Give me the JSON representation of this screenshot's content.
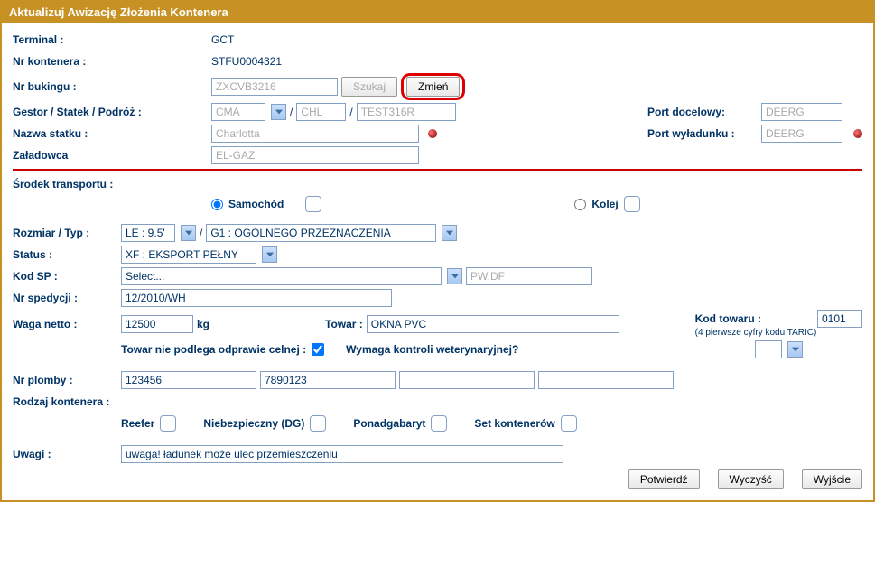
{
  "title": "Aktualizuj Awizację Złożenia Kontenera",
  "labels": {
    "terminal": "Terminal :",
    "kontenera": "Nr kontenera :",
    "bukingu": "Nr bukingu :",
    "gestor": "Gestor / Statek / Podróż :",
    "nazwa_statku": "Nazwa statku :",
    "zaladowca": "Załadowca",
    "port_docelowy": "Port docelowy:",
    "port_wyladunku": "Port wyładunku :",
    "srodek": "Środek transportu :",
    "samochod": "Samochód",
    "kolej": "Kolej",
    "rozmiar": "Rozmiar / Typ :",
    "status": "Status :",
    "kod_sp": "Kod SP :",
    "nr_spedycji": "Nr spedycji :",
    "waga": "Waga netto :",
    "kg": "kg",
    "towar": "Towar :",
    "kod_towaru": "Kod towaru :",
    "taric_note": "(4 pierwsze cyfry kodu TARIC)",
    "odprawa": "Towar nie podlega odprawie celnej :",
    "weterynaryjna": "Wymaga kontroli weterynaryjnej?",
    "nr_plomby": "Nr plomby :",
    "rodzaj": "Rodzaj kontenera :",
    "reefer": "Reefer",
    "dg": "Niebezpieczny (DG)",
    "ponadgabaryt": "Ponadgabaryt",
    "set": "Set kontenerów",
    "uwagi": "Uwagi :"
  },
  "vals": {
    "terminal": "GCT",
    "kontenera": "STFU0004321",
    "bukingu": "ZXCVB3216",
    "gestor": "CMA",
    "statek": "CHL",
    "podroz": "TEST316R",
    "nazwa_statku": "Charlotta",
    "zaladowca": "EL-GAZ",
    "port_docelowy": "DEERG",
    "port_wyladunku": "DEERG",
    "rozmiar": "LE : 9.5'",
    "typ": "G1 : OGÓLNEGO PRZEZNACZENIA",
    "status": "XF : EKSPORT PEŁNY",
    "kod_sp_sel": "Select...",
    "kod_sp_txt": "PW,DF",
    "nr_spedycji": "12/2010/WH",
    "waga": "12500",
    "towar": "OKNA PVC",
    "kod_towaru": "0101",
    "plomba1": "123456",
    "plomba2": "7890123",
    "plomba3": "",
    "plomba4": "",
    "uwagi": "uwaga! ładunek może ulec przemieszczeniu"
  },
  "btns": {
    "szukaj": "Szukaj",
    "zmien": "Zmień",
    "potwierdz": "Potwierdź",
    "wyczysc": "Wyczyść",
    "wyjscie": "Wyjście"
  }
}
